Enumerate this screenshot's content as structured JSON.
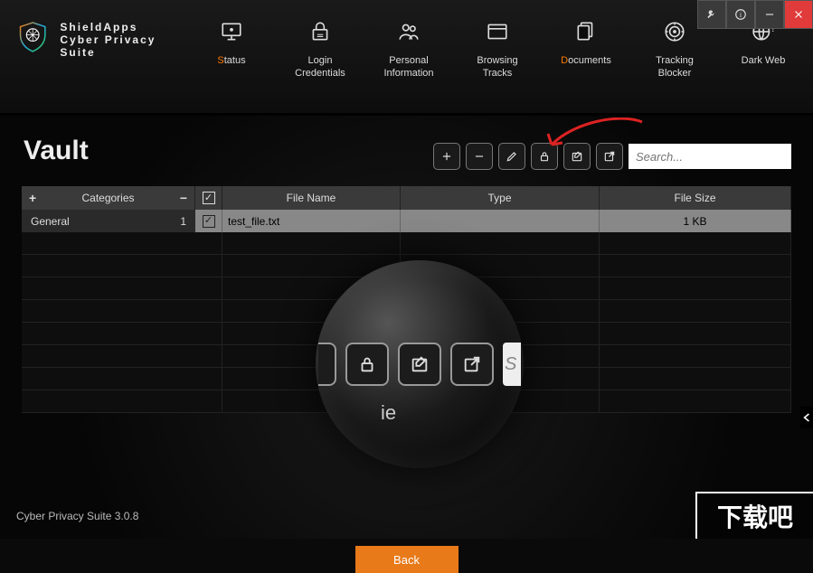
{
  "window_controls": {
    "settings": "settings",
    "info": "info",
    "minimize": "minimize",
    "close": "close"
  },
  "brand": {
    "top": "ShieldApps",
    "bottom": "Cyber Privacy Suite"
  },
  "nav": [
    {
      "label": "Status",
      "hotkey": "S"
    },
    {
      "label": "Login Credentials"
    },
    {
      "label": "Personal Information"
    },
    {
      "label": "Browsing Tracks"
    },
    {
      "label": "Documents",
      "hotkey": "D"
    },
    {
      "label": "Tracking Blocker"
    },
    {
      "label": "Dark Web"
    }
  ],
  "page": {
    "title": "Vault"
  },
  "toolbar": {
    "search_placeholder": "Search...",
    "buttons": [
      "add",
      "remove",
      "edit",
      "lock",
      "rename",
      "open-external"
    ]
  },
  "categories_header": "Categories",
  "categories": [
    {
      "name": "General",
      "count": "1"
    }
  ],
  "file_table": {
    "headers": {
      "name": "File Name",
      "type": "Type",
      "size": "File Size"
    },
    "rows": [
      {
        "name": "test_file.txt",
        "type": "",
        "size": "1 KB",
        "checked": true
      }
    ]
  },
  "magnifier": {
    "text_fragment": "ie",
    "search_fragment": "S"
  },
  "back_button": "Back",
  "footer": "Cyber Privacy Suite 3.0.8",
  "watermark": "下载吧"
}
